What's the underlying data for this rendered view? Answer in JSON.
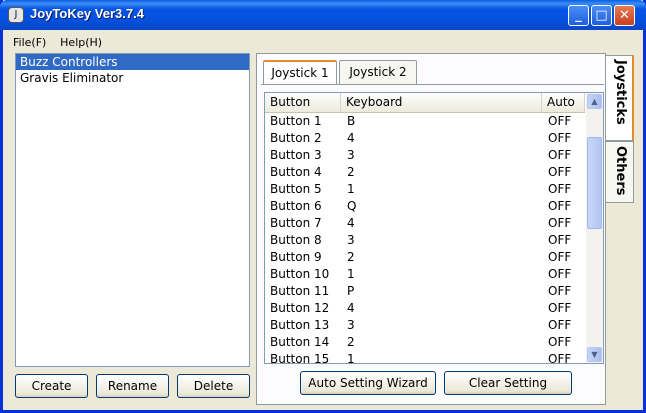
{
  "window": {
    "title": "JoyToKey Ver3.7.4",
    "icon": "joystick-icon"
  },
  "menu": [
    "File(F)",
    "Help(H)"
  ],
  "controllers": {
    "items": [
      "Buzz Controllers",
      "Gravis Eliminator"
    ],
    "selected_index": 0
  },
  "left_buttons": {
    "create": "Create",
    "rename": "Rename",
    "delete": "Delete"
  },
  "subtabs": [
    "Joystick 1",
    "Joystick 2"
  ],
  "grid": {
    "headers": {
      "button": "Button",
      "keyboard": "Keyboard",
      "auto": "Auto"
    },
    "rows": [
      {
        "button": "Button 1",
        "keyboard": "B",
        "auto": "OFF"
      },
      {
        "button": "Button 2",
        "keyboard": "4",
        "auto": "OFF"
      },
      {
        "button": "Button 3",
        "keyboard": "3",
        "auto": "OFF"
      },
      {
        "button": "Button 4",
        "keyboard": "2",
        "auto": "OFF"
      },
      {
        "button": "Button 5",
        "keyboard": "1",
        "auto": "OFF"
      },
      {
        "button": "Button 6",
        "keyboard": "Q",
        "auto": "OFF"
      },
      {
        "button": "Button 7",
        "keyboard": "4",
        "auto": "OFF"
      },
      {
        "button": "Button 8",
        "keyboard": "3",
        "auto": "OFF"
      },
      {
        "button": "Button 9",
        "keyboard": "2",
        "auto": "OFF"
      },
      {
        "button": "Button 10",
        "keyboard": "1",
        "auto": "OFF"
      },
      {
        "button": "Button 11",
        "keyboard": "P",
        "auto": "OFF"
      },
      {
        "button": "Button 12",
        "keyboard": "4",
        "auto": "OFF"
      },
      {
        "button": "Button 13",
        "keyboard": "3",
        "auto": "OFF"
      },
      {
        "button": "Button 14",
        "keyboard": "2",
        "auto": "OFF"
      },
      {
        "button": "Button 15",
        "keyboard": "1",
        "auto": "OFF"
      }
    ]
  },
  "bottom_buttons": {
    "wizard": "Auto Setting Wizard",
    "clear": "Clear Setting"
  },
  "side_tabs": [
    "Joysticks",
    "Others"
  ],
  "colors": {
    "titlebar": "#0555e3",
    "selection": "#316ac5",
    "window_bg": "#ece9d8"
  }
}
